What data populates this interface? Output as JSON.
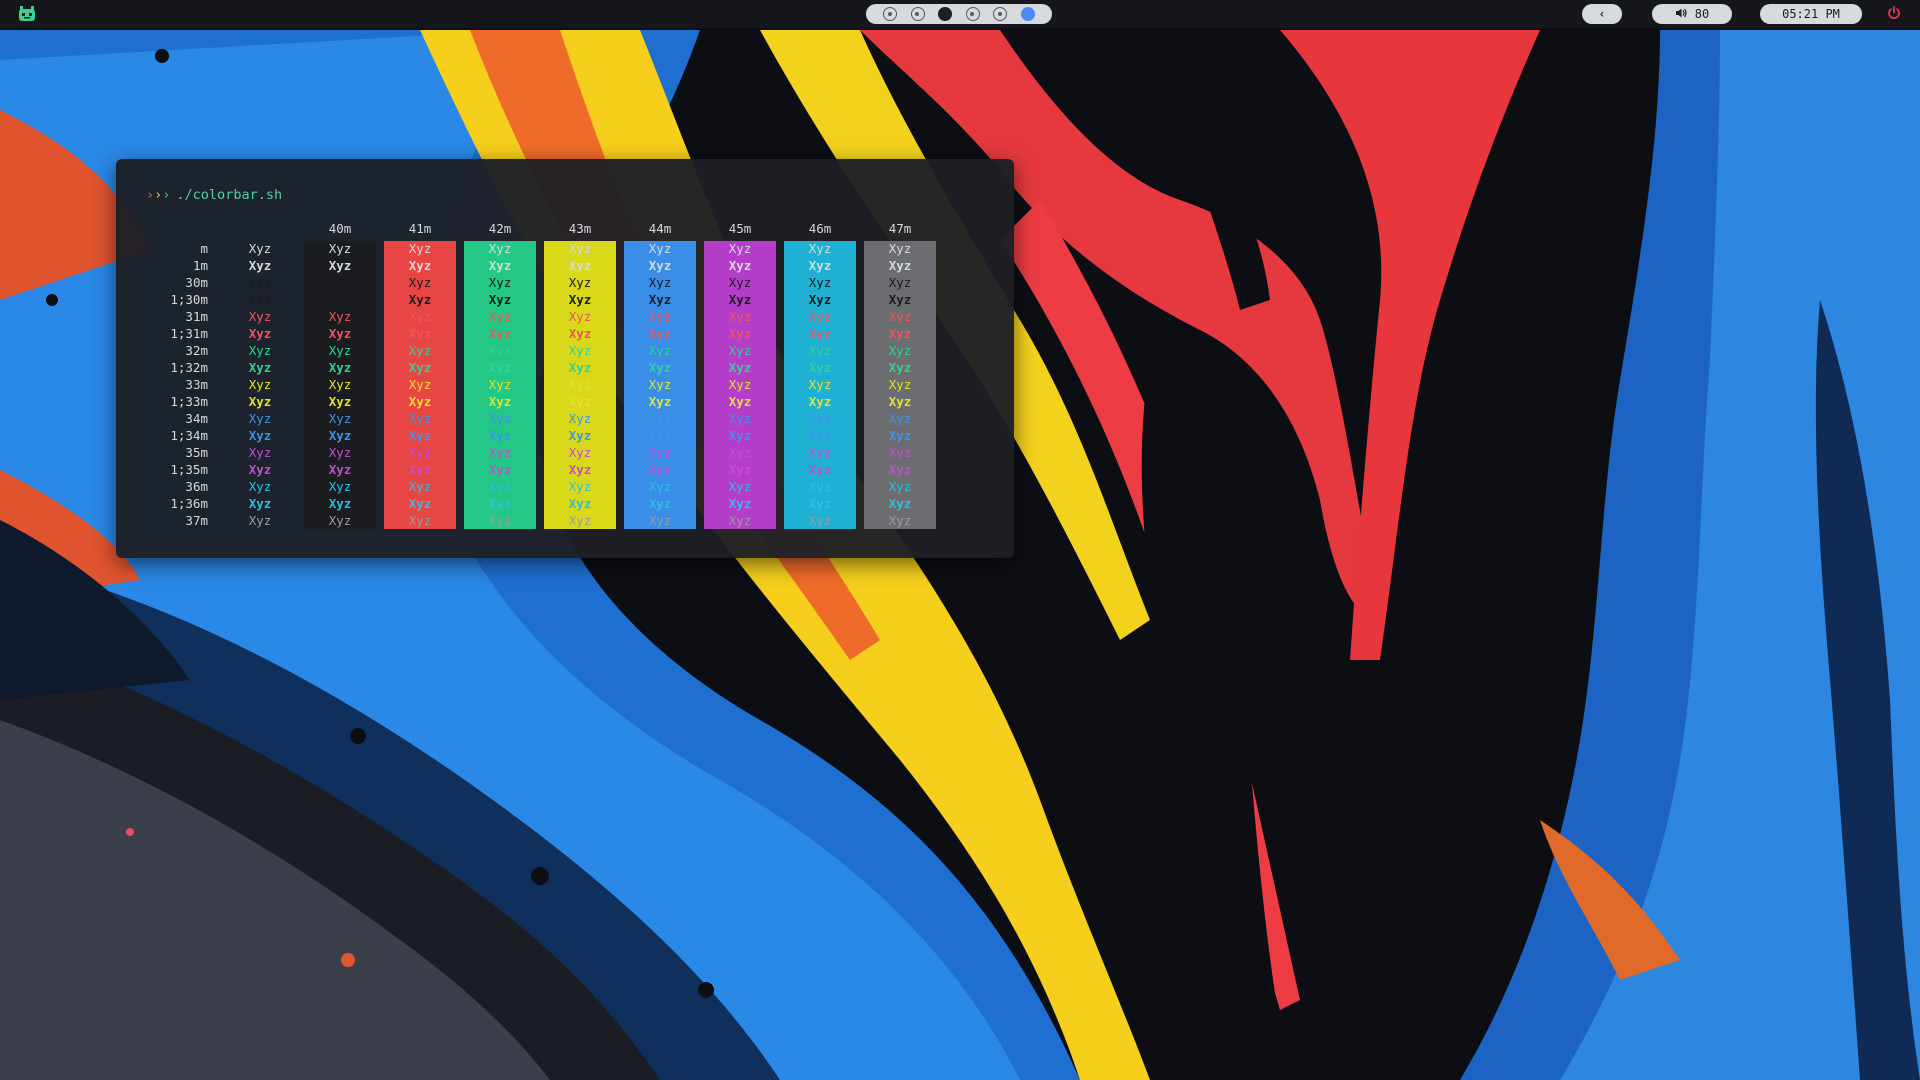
{
  "topbar": {
    "back_label": "‹",
    "volume_icon": "speaker-icon",
    "volume_value": "80",
    "clock": "05:21 PM",
    "workspaces": [
      "inactive",
      "inactive",
      "filled",
      "inactive",
      "inactive",
      "active"
    ]
  },
  "terminal": {
    "prompt_symbols": [
      "›",
      "›",
      "›"
    ],
    "command": "./colorbar.sh",
    "sample_text": "Xyz",
    "fg_codes": [
      "m",
      "1m",
      "30m",
      "1;30m",
      "31m",
      "1;31m",
      "32m",
      "1;32m",
      "33m",
      "1;33m",
      "34m",
      "1;34m",
      "35m",
      "1;35m",
      "36m",
      "1;36m",
      "37m"
    ],
    "bg_codes": [
      "40m",
      "41m",
      "42m",
      "43m",
      "44m",
      "45m",
      "46m",
      "47m"
    ],
    "palette": {
      "default": "#d6d9de",
      "black": "#1a1c20",
      "red": "#e84545",
      "green": "#23c886",
      "yellow": "#d9d91a",
      "blue": "#3b8ee8",
      "magenta": "#b43ec9",
      "cyan": "#20b0d4",
      "white": "#6b6d70"
    },
    "fg_palette": {
      "default": "#d6d9de",
      "black": "#1a1c20",
      "red": "#f2545b",
      "green": "#2fd394",
      "yellow": "#e4e428",
      "blue": "#3e93ee",
      "magenta": "#c94ad8",
      "cyan": "#2cc0e2",
      "white": "#9a9c9f"
    }
  }
}
